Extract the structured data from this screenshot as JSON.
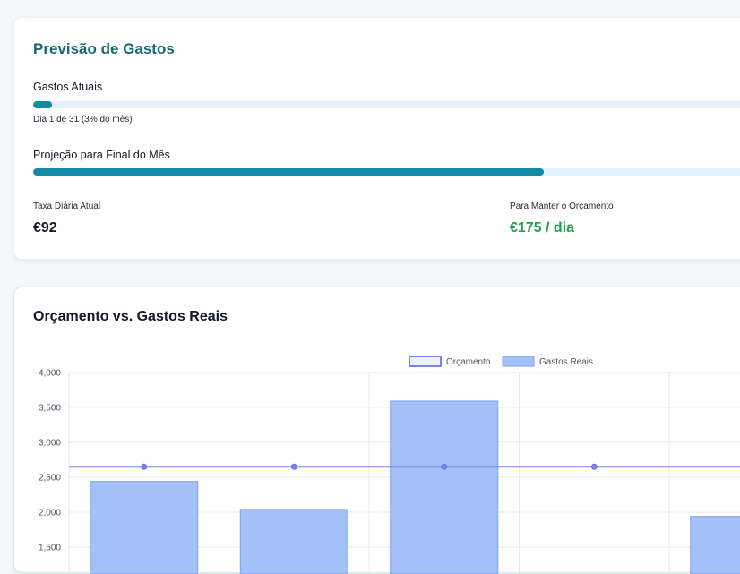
{
  "forecast": {
    "title": "Previsão de Gastos",
    "current_label": "Gastos Atuais",
    "current_progress": 0.025,
    "day_note": "Dia 1 de 31 (3% do mês)",
    "projection_label": "Projeção para Final do Mês",
    "projection_progress": 0.695,
    "daily_rate_label": "Taxa Diária Atual",
    "daily_rate_value": "€92",
    "keep_budget_label": "Para Manter o Orçamento",
    "keep_budget_value": "€175 / dia"
  },
  "colors": {
    "title_teal": "#17677a",
    "progress_fill": "#128aa6",
    "progress_track": "#e1f0fb",
    "green": "#1fa34a",
    "budget_line": "#7b82ec",
    "bar_fill": "#a3c1f7",
    "bar_stroke": "#7aa2f2"
  },
  "chart_title": "Orçamento vs. Gastos Reais",
  "chart_data": {
    "type": "bar",
    "categories": [
      "",
      "",
      "",
      "",
      ""
    ],
    "series": [
      {
        "name": "Orçamento",
        "kind": "line",
        "values": [
          2650,
          2650,
          2650,
          2650,
          2650
        ]
      },
      {
        "name": "Gastos Reais",
        "kind": "bar",
        "values": [
          2440,
          2040,
          3590,
          0,
          1940
        ]
      }
    ],
    "yticks": [
      1500,
      2000,
      2500,
      3000,
      3500,
      4000
    ],
    "ytick_labels": [
      "1,500",
      "2,000",
      "2,500",
      "3,000",
      "3,500",
      "4,000"
    ],
    "ylim": [
      1500,
      4000
    ],
    "grid": true,
    "legend": "top-center"
  }
}
